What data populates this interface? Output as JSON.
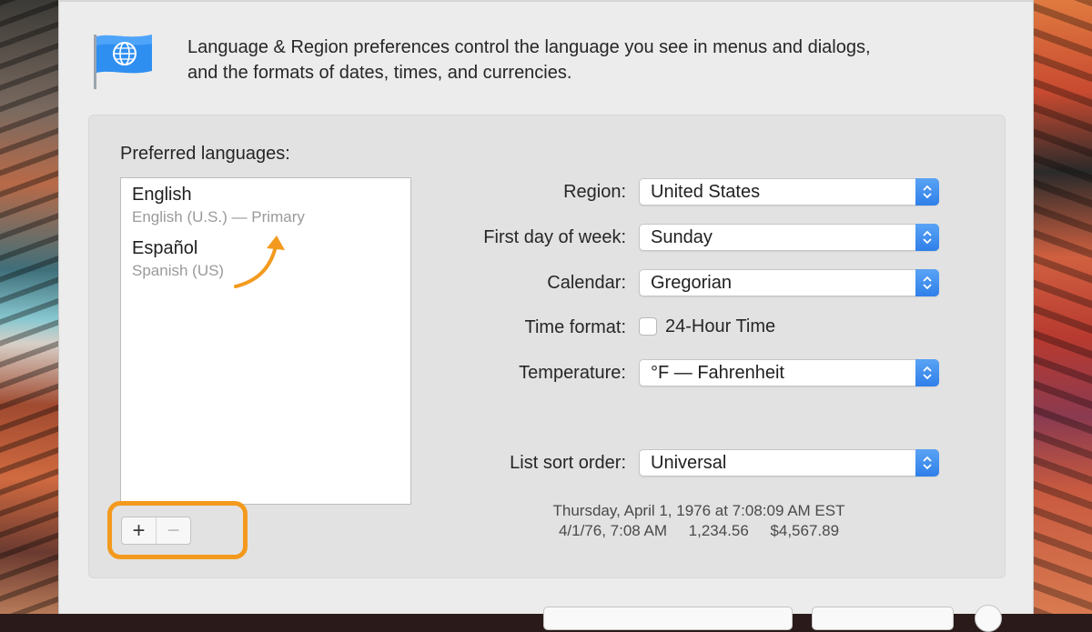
{
  "intro": {
    "line1": "Language & Region preferences control the language you see in menus and dialogs,",
    "line2": "and the formats of dates, times, and currencies."
  },
  "preferred_languages": {
    "label": "Preferred languages:",
    "items": [
      {
        "name": "English",
        "detail": "English (U.S.) — Primary"
      },
      {
        "name": "Español",
        "detail": "Spanish (US)"
      }
    ],
    "add_label": "+",
    "remove_label": "−"
  },
  "settings": {
    "region": {
      "label": "Region:",
      "value": "United States"
    },
    "first_day": {
      "label": "First day of week:",
      "value": "Sunday"
    },
    "calendar": {
      "label": "Calendar:",
      "value": "Gregorian"
    },
    "time_format": {
      "label": "Time format:",
      "checkbox_label": "24-Hour Time",
      "checked": false
    },
    "temperature": {
      "label": "Temperature:",
      "value": "°F — Fahrenheit"
    },
    "sort_order": {
      "label": "List sort order:",
      "value": "Universal"
    }
  },
  "sample": {
    "line1": "Thursday, April 1, 1976 at 7:08:09 AM EST",
    "line2": "4/1/76, 7:08 AM     1,234.56     $4,567.89"
  },
  "colors": {
    "accent": "#2f7fe9",
    "annotation": "#f39a1e",
    "window_bg": "#ececec",
    "panel_bg": "#e2e2e2"
  },
  "icons": {
    "app": "flag-globe-icon",
    "stepper": "chevron-up-down-icon"
  }
}
